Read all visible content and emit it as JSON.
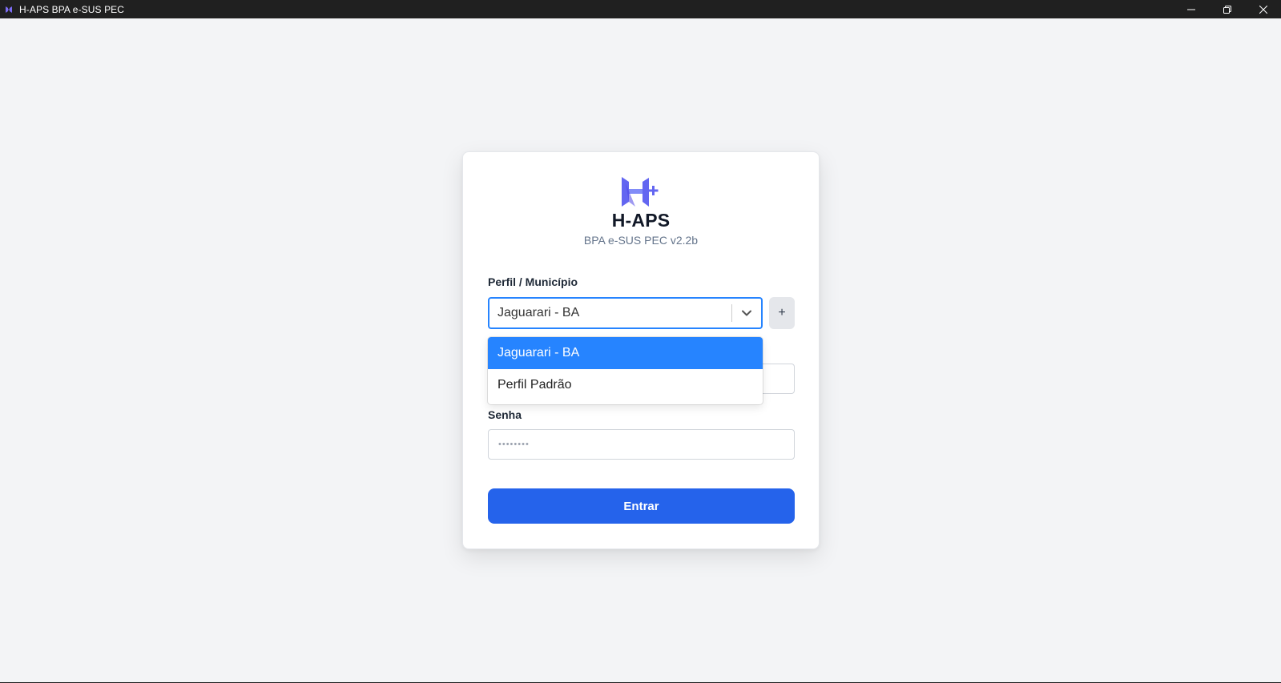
{
  "window": {
    "title": "H-APS BPA e-SUS PEC",
    "controls": [
      "minimize-icon",
      "restore-icon",
      "close-icon"
    ]
  },
  "brand": {
    "name": "H-APS",
    "subtitle": "BPA e-SUS PEC v2.2b",
    "logo_color": "#6366f1"
  },
  "form": {
    "profile_label": "Perfil / Município",
    "profile_selected": "Jaguarari - BA",
    "add_profile_label": "+",
    "password_label": "Senha",
    "password_placeholder": "••••••••",
    "submit_label": "Entrar"
  },
  "dropdown": {
    "options": [
      "Jaguarari - BA",
      "Perfil Padrão"
    ],
    "selected_index": 0
  },
  "colors": {
    "accent": "#2563eb",
    "select_focus": "#2684ff",
    "background": "#f3f4f6",
    "titlebar": "#202020"
  }
}
